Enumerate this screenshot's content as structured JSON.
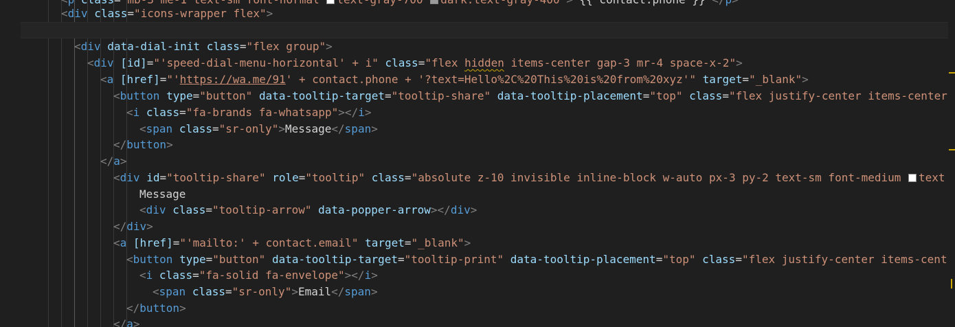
{
  "colors": {
    "background": "#1f1f1f",
    "tag": "#569cd6",
    "attribute": "#9cdcfe",
    "string": "#ce9178",
    "punctuation": "#808080",
    "warning": "#cca700",
    "white_swatch": "#ffffff",
    "gray_swatch": "#9a9a9a"
  },
  "code": {
    "l0": {
      "open": "<",
      "tag": "p",
      "a1": "class",
      "v1": "\"mb-3 me-1 text-sm font-normal ",
      "v1b": "text-gray-700 ",
      "v1c": "dark:text-gray-400\"",
      "close": ">",
      "text": "{{ contact.phone }}",
      "end_open": "</",
      "end_tag": "p",
      "end_close": ">"
    },
    "l1": {
      "open": "<",
      "tag": "div",
      "a1": "class",
      "v1": "\"icons-wrapper flex\"",
      "close": ">"
    },
    "l3": {
      "open": "<",
      "tag": "div",
      "a1": "data-dial-init",
      "a2": "class",
      "v2": "\"flex group\"",
      "close": ">"
    },
    "l4": {
      "open": "<",
      "tag": "div",
      "a1": "[id]",
      "v1": "\"'speed-dial-menu-horizontal' + i\"",
      "a2": "class",
      "v2a": "\"flex ",
      "v2b": "hidden",
      "v2c": " items-center gap-3 mr-4 space-x-2\"",
      "close": ">"
    },
    "l5": {
      "open": "<",
      "tag": "a",
      "a1": "[href]",
      "v1a": "\"'",
      "v1b": "https://wa.me/91",
      "v1c": "' + contact.phone + '?text=Hello%2C%20This%20is%20from%20xyz'\"",
      "a2": "target",
      "v2": "\"_blank\"",
      "close": ">"
    },
    "l6": {
      "open": "<",
      "tag": "button",
      "a1": "type",
      "v1": "\"button\"",
      "a2": "data-tooltip-target",
      "v2": "\"tooltip-share\"",
      "a3": "data-tooltip-placement",
      "v3": "\"top\"",
      "a4": "class",
      "v4": "\"flex justify-center items-center"
    },
    "l7": {
      "open": "<",
      "tag": "i",
      "a1": "class",
      "v1": "\"fa-brands fa-whatsapp\"",
      "close": "></",
      "end_tag": "i",
      "end_close": ">"
    },
    "l8": {
      "open": "<",
      "tag": "span",
      "a1": "class",
      "v1": "\"sr-only\"",
      "close": ">",
      "text": "Message",
      "end_open": "</",
      "end_tag": "span",
      "end_close": ">"
    },
    "l9": {
      "open": "</",
      "tag": "button",
      "close": ">"
    },
    "l10": {
      "open": "</",
      "tag": "a",
      "close": ">"
    },
    "l11": {
      "open": "<",
      "tag": "div",
      "a1": "id",
      "v1": "\"tooltip-share\"",
      "a2": "role",
      "v2": "\"tooltip\"",
      "a3": "class",
      "v3": "\"absolute z-10 invisible inline-block w-auto px-3 py-2 text-sm font-medium ",
      "v3b": "text"
    },
    "l12": {
      "text": "Message"
    },
    "l13": {
      "open": "<",
      "tag": "div",
      "a1": "class",
      "v1": "\"tooltip-arrow\"",
      "a2": "data-popper-arrow",
      "close": "></",
      "end_tag": "div",
      "end_close": ">"
    },
    "l14": {
      "open": "</",
      "tag": "div",
      "close": ">"
    },
    "l15": {
      "open": "<",
      "tag": "a",
      "a1": "[href]",
      "v1": "\"'mailto:' + contact.email\"",
      "a2": "target",
      "v2": "\"_blank\"",
      "close": ">"
    },
    "l16": {
      "open": "<",
      "tag": "button",
      "a1": "type",
      "v1": "\"button\"",
      "a2": "data-tooltip-target",
      "v2": "\"tooltip-print\"",
      "a3": "data-tooltip-placement",
      "v3": "\"top\"",
      "a4": "class",
      "v4": "\"flex justify-center items-cent"
    },
    "l17": {
      "open": "<",
      "tag": "i",
      "a1": "class",
      "v1": "\"fa-solid fa-envelope\"",
      "close": "></",
      "end_tag": "i",
      "end_close": ">"
    },
    "l18": {
      "open": "<",
      "tag": "span",
      "a1": "class",
      "v1": "\"sr-only\"",
      "close": ">",
      "text": "Email",
      "end_open": "</",
      "end_tag": "span",
      "end_close": ">"
    },
    "l19": {
      "open": "</",
      "tag": "button",
      "close": ">"
    },
    "l20": {
      "open": "</",
      "tag": "a",
      "close": ">"
    }
  }
}
